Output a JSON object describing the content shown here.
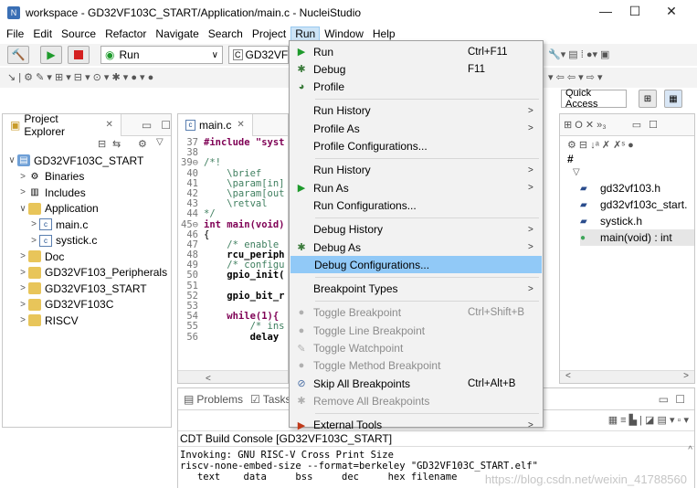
{
  "window": {
    "title": "workspace - GD32VF103C_START/Application/main.c - NucleiStudio",
    "minimize": "—",
    "maximize": "☐",
    "close": "✕"
  },
  "menubar": [
    "File",
    "Edit",
    "Source",
    "Refactor",
    "Navigate",
    "Search",
    "Project",
    "Run",
    "Window",
    "Help"
  ],
  "toolbar": {
    "run_combo": "Run",
    "target_combo": "GD32VF1",
    "quick_access": "Quick Access"
  },
  "project_explorer": {
    "tab": "Project Explorer",
    "items": [
      {
        "label": "GD32VF103C_START",
        "indent": 0,
        "arrow": "∨",
        "icon": "project-icon"
      },
      {
        "label": "Binaries",
        "indent": 1,
        "arrow": ">",
        "icon": "binaries-icon"
      },
      {
        "label": "Includes",
        "indent": 1,
        "arrow": ">",
        "icon": "includes-icon"
      },
      {
        "label": "Application",
        "indent": 1,
        "arrow": "∨",
        "icon": "folder-icon"
      },
      {
        "label": "main.c",
        "indent": 2,
        "arrow": ">",
        "icon": "c-file-icon"
      },
      {
        "label": "systick.c",
        "indent": 2,
        "arrow": ">",
        "icon": "c-file-icon"
      },
      {
        "label": "Doc",
        "indent": 1,
        "arrow": ">",
        "icon": "folder-icon"
      },
      {
        "label": "GD32VF103_Peripherals",
        "indent": 1,
        "arrow": ">",
        "icon": "folder-icon"
      },
      {
        "label": "GD32VF103_START",
        "indent": 1,
        "arrow": ">",
        "icon": "folder-icon"
      },
      {
        "label": "GD32VF103C",
        "indent": 1,
        "arrow": ">",
        "icon": "folder-icon"
      },
      {
        "label": "RISCV",
        "indent": 1,
        "arrow": ">",
        "icon": "folder-icon"
      }
    ]
  },
  "editor": {
    "tab": "main.c",
    "lines": [
      {
        "n": "37",
        "t": "#include \"syst"
      },
      {
        "n": "38",
        "t": ""
      },
      {
        "n": "39⊖",
        "t": "/*!"
      },
      {
        "n": "40",
        "t": "    \\brief"
      },
      {
        "n": "41",
        "t": "    \\param[in]"
      },
      {
        "n": "42",
        "t": "    \\param[out"
      },
      {
        "n": "43",
        "t": "    \\retval"
      },
      {
        "n": "44",
        "t": "*/"
      },
      {
        "n": "45⊖",
        "t": "int main(void)"
      },
      {
        "n": "46",
        "t": "{"
      },
      {
        "n": "47",
        "t": "    /* enable"
      },
      {
        "n": "48",
        "t": "    rcu_periph"
      },
      {
        "n": "49",
        "t": "    /* configu"
      },
      {
        "n": "50",
        "t": "    gpio_init("
      },
      {
        "n": "51",
        "t": ""
      },
      {
        "n": "52",
        "t": "    gpio_bit_r"
      },
      {
        "n": "53",
        "t": ""
      },
      {
        "n": "54",
        "t": "    while(1){"
      },
      {
        "n": "55",
        "t": "        /* ins"
      },
      {
        "n": "56",
        "t": "        delay"
      }
    ]
  },
  "outline": {
    "items": [
      {
        "label": "gd32vf103.h",
        "icon": "include-icon"
      },
      {
        "label": "gd32vf103c_start.",
        "icon": "include-icon"
      },
      {
        "label": "systick.h",
        "icon": "include-icon"
      },
      {
        "label": "main(void) : int",
        "icon": "function-icon"
      }
    ]
  },
  "bottom": {
    "tabs": [
      "Problems",
      "Tasks"
    ],
    "console_title": "CDT Build Console [GD32VF103C_START]",
    "lines": [
      "Invoking: GNU RISC-V Cross Print Size",
      "riscv-none-embed-size --format=berkeley \"GD32VF103C_START.elf\"",
      "   text    data     bss     dec     hex filename"
    ],
    "watermark": "https://blog.csdn.net/weixin_41788560"
  },
  "run_menu": {
    "items": [
      {
        "label": "Run",
        "accel": "Ctrl+F11",
        "icon": "run-icon",
        "arrow": "",
        "disabled": false,
        "hl": false
      },
      {
        "label": "Debug",
        "accel": "F11",
        "icon": "debug-icon",
        "arrow": "",
        "disabled": false,
        "hl": false
      },
      {
        "label": "Profile",
        "accel": "",
        "icon": "profile-icon",
        "arrow": "",
        "disabled": false,
        "hl": false
      },
      {
        "sep": true
      },
      {
        "label": "Run History",
        "accel": "",
        "icon": "",
        "arrow": ">",
        "disabled": false,
        "hl": false
      },
      {
        "label": "Profile As",
        "accel": "",
        "icon": "",
        "arrow": ">",
        "disabled": false,
        "hl": false
      },
      {
        "label": "Profile Configurations...",
        "accel": "",
        "icon": "",
        "arrow": "",
        "disabled": false,
        "hl": false
      },
      {
        "sep": true
      },
      {
        "label": "Run History",
        "accel": "",
        "icon": "",
        "arrow": ">",
        "disabled": false,
        "hl": false
      },
      {
        "label": "Run As",
        "accel": "",
        "icon": "run-as-icon",
        "arrow": ">",
        "disabled": false,
        "hl": false
      },
      {
        "label": "Run Configurations...",
        "accel": "",
        "icon": "",
        "arrow": "",
        "disabled": false,
        "hl": false
      },
      {
        "sep": true
      },
      {
        "label": "Debug History",
        "accel": "",
        "icon": "",
        "arrow": ">",
        "disabled": false,
        "hl": false
      },
      {
        "label": "Debug As",
        "accel": "",
        "icon": "debug-as-icon",
        "arrow": ">",
        "disabled": false,
        "hl": false
      },
      {
        "label": "Debug Configurations...",
        "accel": "",
        "icon": "",
        "arrow": "",
        "disabled": false,
        "hl": true
      },
      {
        "sep": true
      },
      {
        "label": "Breakpoint Types",
        "accel": "",
        "icon": "",
        "arrow": ">",
        "disabled": false,
        "hl": false
      },
      {
        "sep": true
      },
      {
        "label": "Toggle Breakpoint",
        "accel": "Ctrl+Shift+B",
        "icon": "breakpoint-icon",
        "arrow": "",
        "disabled": true,
        "hl": false
      },
      {
        "label": "Toggle Line Breakpoint",
        "accel": "",
        "icon": "line-breakpoint-icon",
        "arrow": "",
        "disabled": true,
        "hl": false
      },
      {
        "label": "Toggle Watchpoint",
        "accel": "",
        "icon": "watchpoint-icon",
        "arrow": "",
        "disabled": true,
        "hl": false
      },
      {
        "label": "Toggle Method Breakpoint",
        "accel": "",
        "icon": "method-breakpoint-icon",
        "arrow": "",
        "disabled": true,
        "hl": false
      },
      {
        "label": "Skip All Breakpoints",
        "accel": "Ctrl+Alt+B",
        "icon": "skip-breakpoints-icon",
        "arrow": "",
        "disabled": false,
        "hl": false
      },
      {
        "label": "Remove All Breakpoints",
        "accel": "",
        "icon": "remove-breakpoints-icon",
        "arrow": "",
        "disabled": true,
        "hl": false
      },
      {
        "sep": true
      },
      {
        "label": "External Tools",
        "accel": "",
        "icon": "external-tools-icon",
        "arrow": ">",
        "disabled": false,
        "hl": false
      }
    ]
  }
}
